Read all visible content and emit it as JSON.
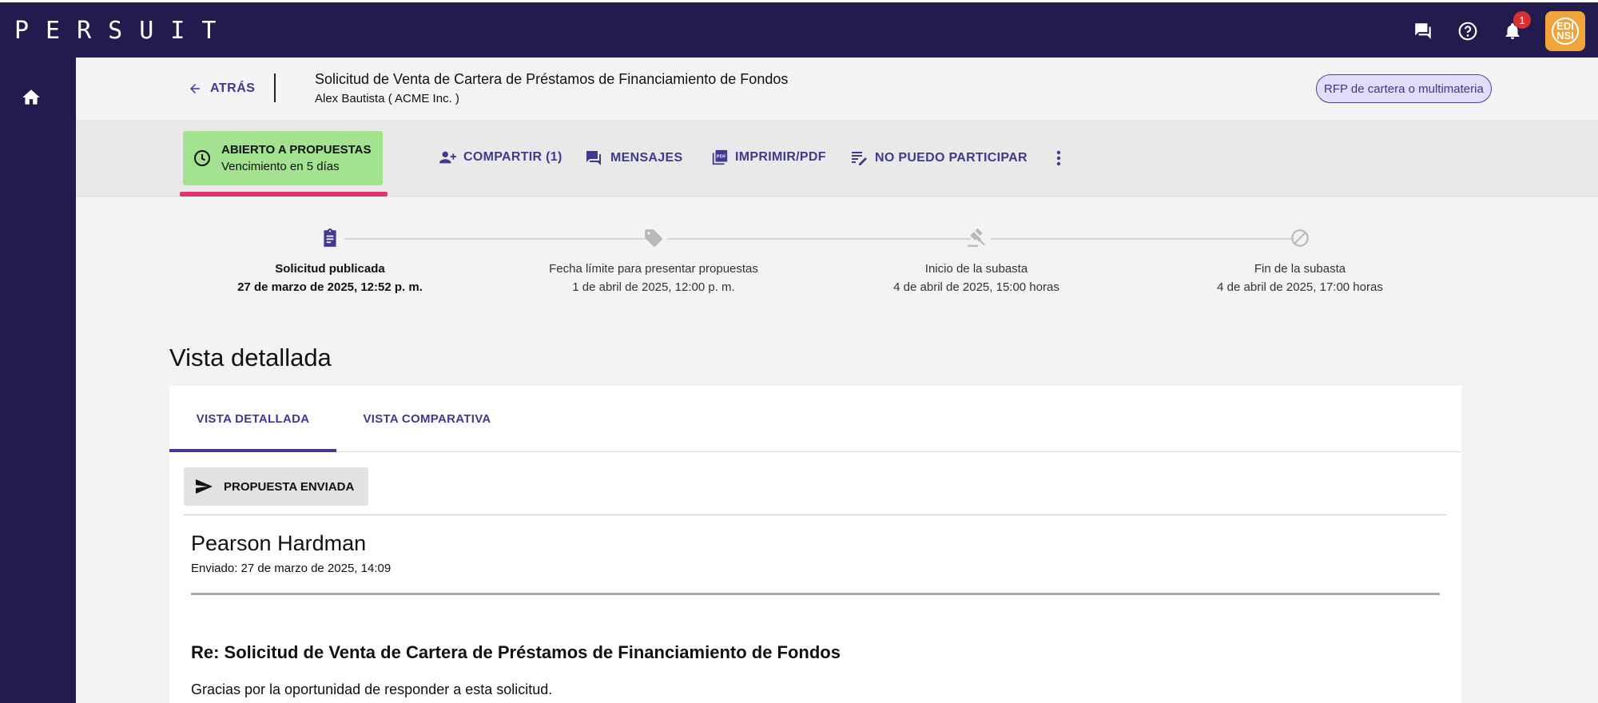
{
  "app": {
    "logo": "PERSUIT",
    "notification_count": "1",
    "avatar_text": "EDI NSI"
  },
  "header": {
    "back_label": "ATRÁS",
    "title": "Solicitud de Venta de Cartera de Préstamos de Financiamiento de Fondos",
    "subtitle": "Alex Bautista ( ACME Inc. )",
    "rfp_type": "RFP de cartera o multimateria"
  },
  "status": {
    "title": "ABIERTO A PROPUESTAS",
    "subtitle": "Vencimiento en 5 días",
    "color": "#a3e28f",
    "underline_color": "#e3336e"
  },
  "actions": {
    "share": "COMPARTIR (1)",
    "messages": "MENSAJES",
    "print": "IMPRIMIR/PDF",
    "decline": "NO PUEDO PARTICIPAR"
  },
  "timeline": [
    {
      "label": "Solicitud publicada",
      "date": "27 de marzo de 2025, 12:52 p. m.",
      "icon": "clipboard-icon"
    },
    {
      "label": "Fecha límite para presentar propuestas",
      "date": "1 de abril de 2025, 12:00 p. m.",
      "icon": "tag-icon"
    },
    {
      "label": "Inicio de la subasta",
      "date": "4 de abril de 2025, 15:00 horas",
      "icon": "gavel-icon"
    },
    {
      "label": "Fin de la subasta",
      "date": "4 de abril de 2025, 17:00 horas",
      "icon": "block-icon"
    }
  ],
  "main": {
    "heading": "Vista detallada",
    "tabs": [
      {
        "label": "VISTA DETALLADA"
      },
      {
        "label": "VISTA COMPARATIVA"
      }
    ],
    "proposal_status": "PROPUESTA ENVIADA",
    "firm_name": "Pearson Hardman",
    "sent_date": "Enviado: 27 de marzo de 2025, 14:09",
    "re_title": "Re: Solicitud de Venta de Cartera de Préstamos de Financiamiento de Fondos",
    "body_first_line": "Gracias por la oportunidad de responder a esta solicitud."
  },
  "colors": {
    "nav": "#211b4e",
    "accent": "#3f3a8f",
    "chip_bg": "#e2ddfb"
  }
}
